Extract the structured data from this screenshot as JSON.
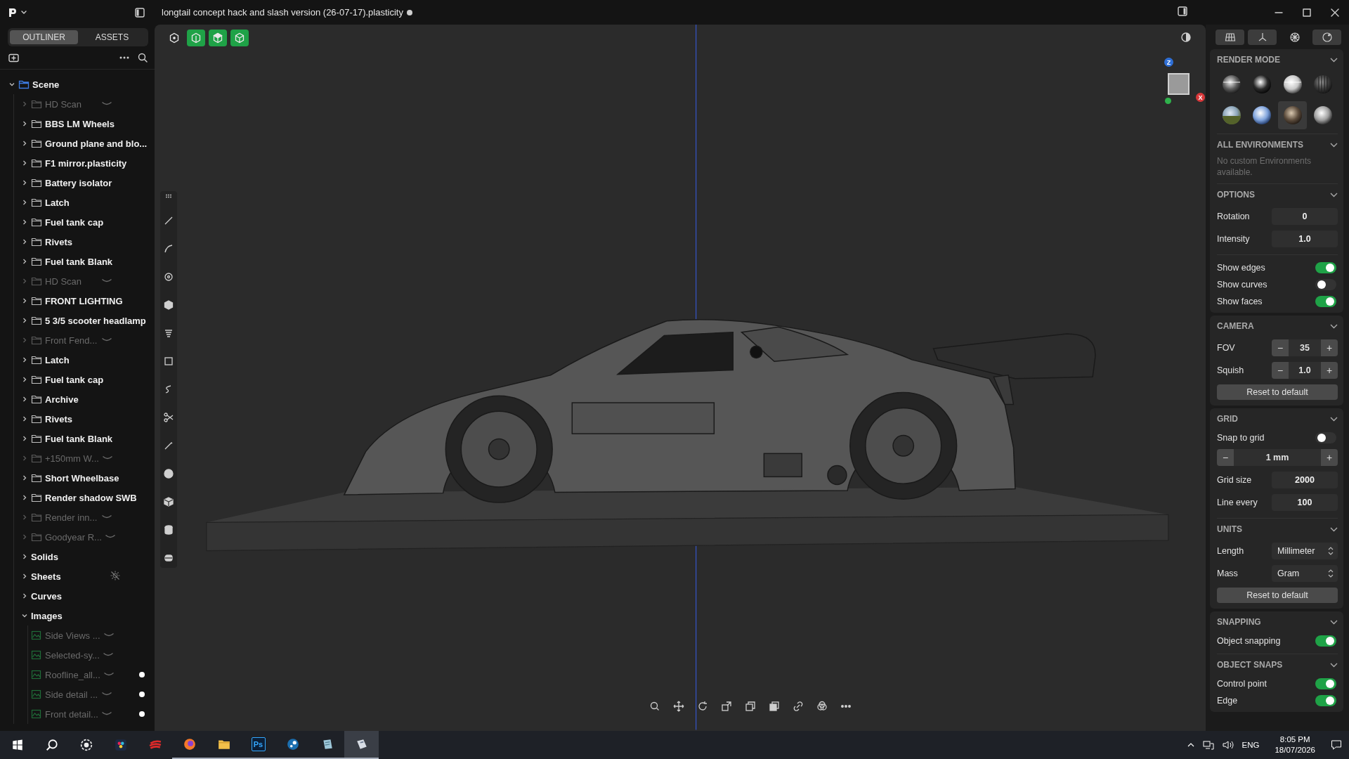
{
  "titlebar": {
    "title": "longtail concept hack and slash version (26-07-17).plasticity",
    "unsaved": true
  },
  "outliner": {
    "tabs": [
      {
        "label": "OUTLINER",
        "selected": true
      },
      {
        "label": "ASSETS",
        "selected": false
      }
    ],
    "items": [
      {
        "label": "Scene",
        "kind": "scene",
        "expanded": true,
        "hidden": false,
        "children": [
          {
            "label": "HD Scan",
            "kind": "folder",
            "expanded": false,
            "hidden": true
          },
          {
            "label": "BBS LM Wheels",
            "kind": "folder",
            "expanded": false,
            "hidden": false
          },
          {
            "label": "Ground plane and blo...",
            "kind": "folder",
            "expanded": false,
            "hidden": false
          },
          {
            "label": "F1 mirror.plasticity",
            "kind": "folder",
            "expanded": false,
            "hidden": false
          },
          {
            "label": "Battery isolator",
            "kind": "folder",
            "expanded": false,
            "hidden": false
          },
          {
            "label": "Latch",
            "kind": "folder",
            "expanded": false,
            "hidden": false
          },
          {
            "label": "Fuel tank cap",
            "kind": "folder",
            "expanded": false,
            "hidden": false
          },
          {
            "label": "Rivets",
            "kind": "folder",
            "expanded": false,
            "hidden": false
          },
          {
            "label": "Fuel tank Blank",
            "kind": "folder",
            "expanded": false,
            "hidden": false
          },
          {
            "label": "HD Scan",
            "kind": "folder",
            "expanded": false,
            "hidden": true
          },
          {
            "label": "FRONT LIGHTING",
            "kind": "folder",
            "expanded": false,
            "hidden": false
          },
          {
            "label": "5 3/5 scooter headlamp",
            "kind": "folder",
            "expanded": false,
            "hidden": false
          },
          {
            "label": "Front Fend...",
            "kind": "folder",
            "expanded": false,
            "hidden": true
          },
          {
            "label": "Latch",
            "kind": "folder",
            "expanded": false,
            "hidden": false
          },
          {
            "label": "Fuel tank cap",
            "kind": "folder",
            "expanded": false,
            "hidden": false
          },
          {
            "label": "Archive",
            "kind": "folder",
            "expanded": false,
            "hidden": false
          },
          {
            "label": "Rivets",
            "kind": "folder",
            "expanded": false,
            "hidden": false
          },
          {
            "label": "Fuel tank Blank",
            "kind": "folder",
            "expanded": false,
            "hidden": false
          },
          {
            "label": "+150mm W...",
            "kind": "folder",
            "expanded": false,
            "hidden": true
          },
          {
            "label": "Short Wheelbase",
            "kind": "folder",
            "expanded": false,
            "hidden": false
          },
          {
            "label": "Render shadow SWB",
            "kind": "folder",
            "expanded": false,
            "hidden": false
          },
          {
            "label": "Render inn...",
            "kind": "folder",
            "expanded": false,
            "hidden": true
          },
          {
            "label": "Goodyear R...",
            "kind": "folder",
            "expanded": false,
            "hidden": true
          },
          {
            "label": "Solids",
            "kind": "group",
            "expanded": false,
            "hidden": false,
            "lights_off": false
          },
          {
            "label": "Sheets",
            "kind": "group",
            "expanded": false,
            "hidden": false,
            "lights_off": true
          },
          {
            "label": "Curves",
            "kind": "group",
            "expanded": false,
            "hidden": false,
            "lights_off": false
          },
          {
            "label": "Images",
            "kind": "group",
            "expanded": true,
            "hidden": false,
            "lights_off": false,
            "children": [
              {
                "label": "Side Views ...",
                "kind": "image",
                "hidden": true,
                "marked": false
              },
              {
                "label": "Selected-sy...",
                "kind": "image",
                "hidden": true,
                "marked": false
              },
              {
                "label": "Roofline_all...",
                "kind": "image",
                "hidden": true,
                "marked": true
              },
              {
                "label": "Side detail ...",
                "kind": "image",
                "hidden": true,
                "marked": true
              },
              {
                "label": "Front detail...",
                "kind": "image",
                "hidden": true,
                "marked": true
              }
            ]
          }
        ]
      }
    ]
  },
  "viewport": {
    "toolbar": [
      {
        "on": false
      },
      {
        "on": true
      },
      {
        "on": true
      },
      {
        "on": true
      }
    ],
    "view_cube": {
      "axes": [
        {
          "label": "Z",
          "color": "#2f6fd6"
        },
        {
          "label": "X",
          "color": "#d8383a"
        }
      ]
    }
  },
  "properties": {
    "view_tabs": [
      {
        "on": true
      },
      {
        "on": true
      },
      {
        "on": false
      },
      {
        "on": true
      }
    ],
    "render_mode": {
      "title": "RENDER MODE",
      "environments": [
        {
          "kind": "studio",
          "selected": false
        },
        {
          "kind": "dark",
          "selected": false
        },
        {
          "kind": "chrome",
          "selected": false
        },
        {
          "kind": "striped",
          "selected": false
        },
        {
          "kind": "landscape",
          "selected": false
        },
        {
          "kind": "blue",
          "selected": false
        },
        {
          "kind": "bronze",
          "selected": true
        },
        {
          "kind": "silver",
          "selected": false
        }
      ]
    },
    "all_environments": {
      "title": "ALL ENVIRONMENTS",
      "message": "No custom Environments available."
    },
    "options": {
      "title": "OPTIONS",
      "fields": [
        {
          "label": "Rotation",
          "value": "0"
        },
        {
          "label": "Intensity",
          "value": "1.0"
        }
      ],
      "toggles": [
        {
          "label": "Show edges",
          "on": true
        },
        {
          "label": "Show curves",
          "on": false
        },
        {
          "label": "Show faces",
          "on": true
        }
      ]
    },
    "camera": {
      "title": "CAMERA",
      "steppers": [
        {
          "label": "FOV",
          "value": "35",
          "decrement": "−",
          "increment": "+"
        },
        {
          "label": "Squish",
          "value": "1.0",
          "decrement": "−",
          "increment": "+"
        }
      ],
      "reset": "Reset to default"
    },
    "grid": {
      "title": "GRID",
      "toggle": {
        "label": "Snap to grid",
        "on": false
      },
      "stepper": {
        "value": "1 mm",
        "decrement": "−",
        "increment": "+"
      },
      "fields": [
        {
          "label": "Grid size",
          "value": "2000"
        },
        {
          "label": "Line every",
          "value": "100"
        }
      ]
    },
    "units": {
      "title": "UNITS",
      "selects": [
        {
          "label": "Length",
          "value": "Millimeter"
        },
        {
          "label": "Mass",
          "value": "Gram"
        }
      ],
      "reset": "Reset to default"
    },
    "snapping": {
      "title": "SNAPPING",
      "toggles": [
        {
          "label": "Object snapping",
          "on": true
        }
      ]
    },
    "object_snaps": {
      "title": "OBJECT SNAPS",
      "toggles": [
        {
          "label": "Control point",
          "on": true
        },
        {
          "label": "Edge",
          "on": true
        }
      ]
    }
  },
  "taskbar": {
    "apps": [
      {
        "running": false,
        "selected": false
      },
      {
        "running": false,
        "selected": false
      },
      {
        "running": false,
        "selected": false
      },
      {
        "running": false,
        "selected": false
      },
      {
        "running": false,
        "selected": false
      },
      {
        "running": true,
        "selected": false
      },
      {
        "running": true,
        "selected": false
      },
      {
        "label": "Ps",
        "running": true,
        "selected": false
      },
      {
        "running": true,
        "selected": false
      },
      {
        "running": true,
        "selected": false
      },
      {
        "running": true,
        "selected": true
      }
    ],
    "language": "ENG",
    "time": "8:05 PM",
    "date": "18/07/2026"
  }
}
